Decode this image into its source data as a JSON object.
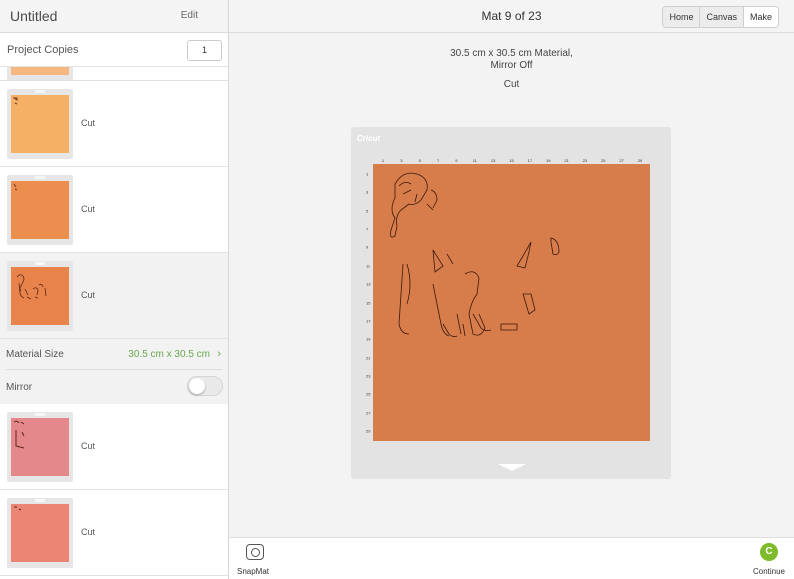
{
  "left_panel": {
    "title": "Untitled",
    "edit_label": "Edit",
    "copies_label": "Project Copies",
    "copies_value": "1",
    "mats": [
      {
        "label": "Cut",
        "color": "#f5b066"
      },
      {
        "label": "Cut",
        "color": "#ec8e4e"
      },
      {
        "label": "Cut",
        "color": "#e8834b"
      },
      {
        "label": "Cut",
        "color": "#e4888c"
      },
      {
        "label": "Cut",
        "color": "#ec8574"
      }
    ],
    "partial_mat_color": "#f5b880",
    "material_size_label": "Material Size",
    "material_size_value": "30.5 cm x 30.5 cm",
    "mirror_label": "Mirror"
  },
  "header": {
    "title": "Mat 9 of 23",
    "tabs": [
      {
        "label": "Home"
      },
      {
        "label": "Canvas"
      },
      {
        "label": "Make"
      }
    ]
  },
  "mat_info": {
    "line1": "30.5 cm x 30.5 cm Material,",
    "line2": "Mirror Off",
    "mode": "Cut"
  },
  "mat_preview": {
    "brand": "Cricut",
    "sheet_color": "#d77c4b",
    "ruler_top": [
      "1",
      "3",
      "5",
      "7",
      "9",
      "11",
      "13",
      "15",
      "17",
      "19",
      "21",
      "23",
      "25",
      "27",
      "29"
    ],
    "ruler_left": [
      "1",
      "3",
      "5",
      "7",
      "9",
      "11",
      "13",
      "15",
      "17",
      "19",
      "21",
      "23",
      "25",
      "27",
      "29"
    ]
  },
  "bottom": {
    "snapmat_label": "SnapMat",
    "continue_label": "Continue",
    "continue_icon_letter": "C"
  }
}
